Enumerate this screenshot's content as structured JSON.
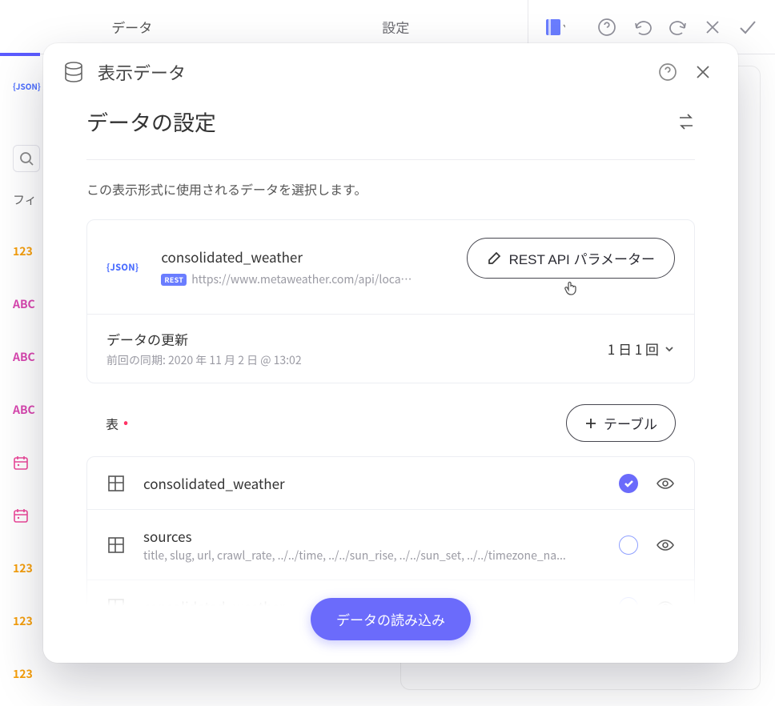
{
  "bg": {
    "tabs": {
      "data": "データ",
      "settings": "設定"
    },
    "left": {
      "filter_label": "フィ",
      "fields": [
        "123",
        "ABC",
        "ABC",
        "ABC",
        "",
        "",
        "123",
        "123",
        "123"
      ]
    }
  },
  "modal": {
    "title": "表示データ",
    "section_title": "データの設定",
    "description": "この表示形式に使用されるデータを選択します。",
    "datasource": {
      "json_label": "JSON",
      "name": "consolidated_weather",
      "rest_badge": "REST",
      "url": "https://www.metaweather.com/api/location...",
      "param_button": "REST API パラメーター"
    },
    "refresh": {
      "label": "データの更新",
      "last_sync": "前回の同期: 2020 年 11 月 2 日 @ 13:02",
      "frequency": "1 日 1 回"
    },
    "tables": {
      "label": "表",
      "add_button": "テーブル",
      "items": [
        {
          "name": "consolidated_weather",
          "sub": "",
          "selected": true
        },
        {
          "name": "sources",
          "sub": "title, slug, url, crawl_rate, ../../time, ../../sun_rise, ../../sun_set, ../../timezone_na...",
          "selected": false
        },
        {
          "name": "consolidated_weather",
          "sub": "",
          "selected": false
        }
      ]
    },
    "footer": {
      "load_button": "データの読み込み"
    }
  }
}
